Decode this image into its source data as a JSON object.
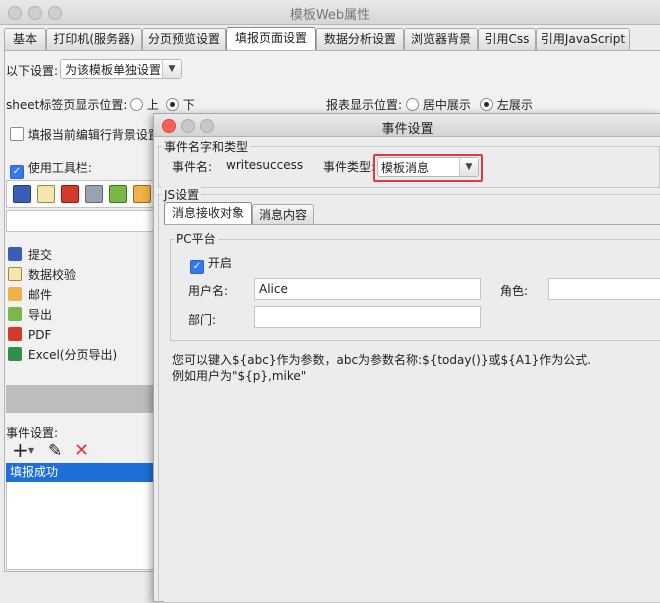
{
  "window": {
    "title": "模板Web属性"
  },
  "tabs": [
    "基本",
    "打印机(服务器)",
    "分页预览设置",
    "填报页面设置",
    "数据分析设置",
    "浏览器背景",
    "引用Css",
    "引用JavaScript"
  ],
  "settings": {
    "scope_label": "以下设置:",
    "scope_value": "为该模板单独设置",
    "sheet_pos_label": "sheet标签页显示位置:",
    "sheet_pos_up": "上",
    "sheet_pos_down": "下",
    "report_pos_label": "报表显示位置:",
    "report_pos_center": "居中展示",
    "report_pos_left": "左展示",
    "fill_bg_label": "填报当前编辑行背景设置",
    "use_toolbar_label": "使用工具栏:"
  },
  "toolbar_actions": [
    "提交",
    "数据校验",
    "邮件",
    "导出",
    "PDF",
    "Excel(分页导出)"
  ],
  "events": {
    "label": "事件设置:",
    "items": [
      "填报成功"
    ]
  },
  "dialog": {
    "title": "事件设置",
    "name_type_group": "事件名字和类型",
    "event_name_label": "事件名:",
    "event_name_value": "writesuccess",
    "event_type_label": "事件类型:",
    "event_type_value": "模板消息",
    "js_group": "JS设置",
    "tabs": [
      "消息接收对象",
      "消息内容"
    ],
    "pc_group": "PC平台",
    "enable_label": "开启",
    "user_label": "用户名:",
    "user_value": "Alice",
    "role_label": "角色:",
    "role_value": "",
    "dept_label": "部门:",
    "dept_value": "",
    "hint_line1": "您可以键入${abc}作为参数，abc为参数名称:${today()}或${A1}作为公式.",
    "hint_line2": "例如用户为\"${p},mike\""
  },
  "colors": {
    "accent": "#1f6fd9",
    "highlight_border": "#e0393e",
    "close": "#fc5f57",
    "minimize": "#c8c8c8"
  }
}
